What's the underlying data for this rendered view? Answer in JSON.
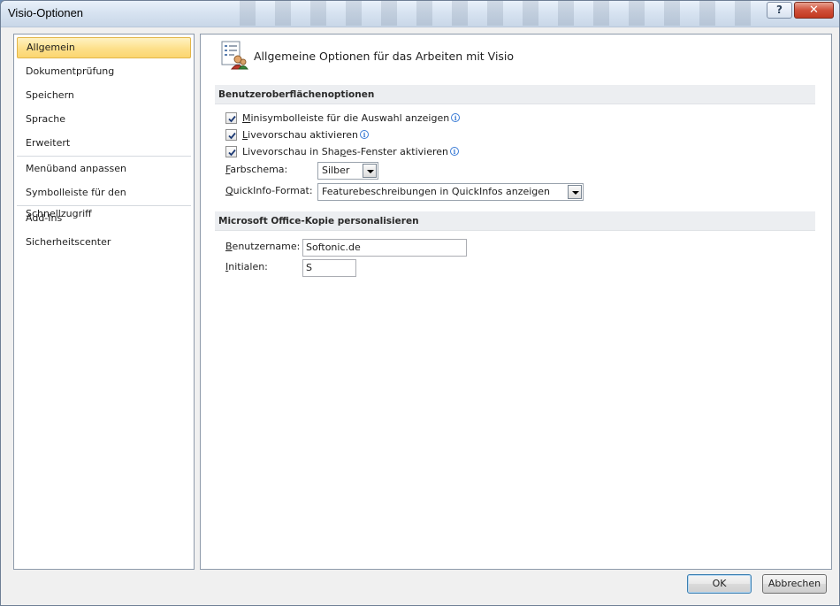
{
  "window": {
    "title": "Visio-Optionen",
    "help_label": "?",
    "close_label": "✕"
  },
  "nav": {
    "items": [
      {
        "label": "Allgemein"
      },
      {
        "label": "Dokumentprüfung"
      },
      {
        "label": "Speichern"
      },
      {
        "label": "Sprache"
      },
      {
        "label": "Erweitert"
      },
      {
        "label": "Menüband anpassen"
      },
      {
        "label": "Symbolleiste für den Schnellzugriff"
      },
      {
        "label": "Add-Ins"
      },
      {
        "label": "Sicherheitscenter"
      }
    ],
    "selected": "Allgemein"
  },
  "content": {
    "header": "Allgemeine Optionen für das Arbeiten mit Visio",
    "sections": {
      "ui": {
        "title": "Benutzeroberflächenoptionen",
        "options": [
          {
            "key": "M",
            "rest": "inisymbolleiste für die Auswahl anzeigen",
            "checked": true
          },
          {
            "key": "L",
            "rest": "ivevorschau aktivieren",
            "checked": true
          },
          {
            "pre": "Livevorschau in Sha",
            "key": "p",
            "rest": "es-Fenster aktivieren",
            "checked": true
          }
        ],
        "color_scheme": {
          "key": "F",
          "rest": "arbschema:",
          "value": "Silber"
        },
        "screentip": {
          "key": "Q",
          "rest": "uickInfo-Format:",
          "value": "Featurebeschreibungen in QuickInfos anzeigen"
        }
      },
      "personalize": {
        "title": "Microsoft Office-Kopie personalisieren",
        "username": {
          "key": "B",
          "rest": "enutzername:",
          "value": "Softonic.de"
        },
        "initials": {
          "key": "I",
          "rest": "nitialen:",
          "value": "S"
        }
      }
    }
  },
  "buttons": {
    "ok": "OK",
    "cancel": "Abbrechen"
  },
  "colors": {
    "selected_nav": "#fde08a",
    "close_button": "#c2381f",
    "info_icon": "#3a7bd5"
  }
}
